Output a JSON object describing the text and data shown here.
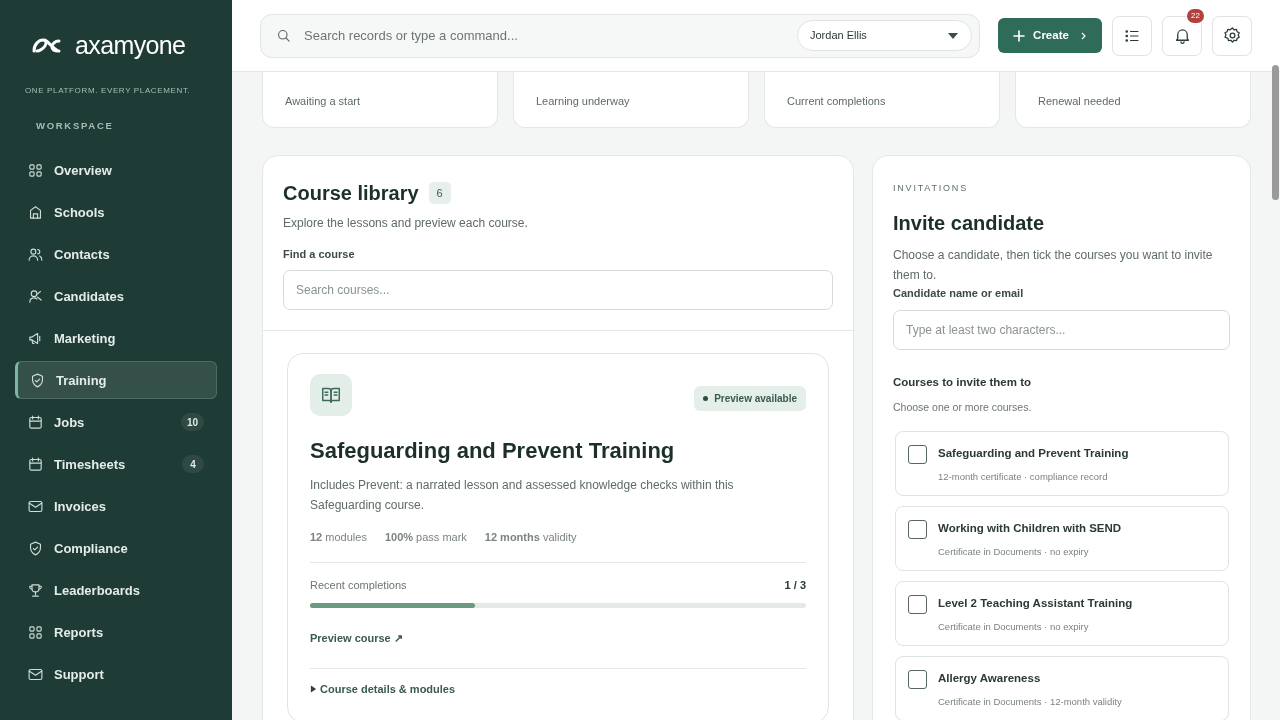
{
  "brand": {
    "name": "axamyone",
    "tagline": "ONE PLATFORM. EVERY PLACEMENT."
  },
  "sidebar": {
    "section": "WORKSPACE",
    "items": [
      {
        "label": "Overview",
        "selected": false
      },
      {
        "label": "Schools",
        "selected": false
      },
      {
        "label": "Contacts",
        "selected": false
      },
      {
        "label": "Candidates",
        "selected": false
      },
      {
        "label": "Marketing",
        "selected": false
      },
      {
        "label": "Training",
        "selected": true
      },
      {
        "label": "Jobs",
        "selected": false,
        "count": "10"
      },
      {
        "label": "Timesheets",
        "selected": false,
        "count": "4"
      },
      {
        "label": "Invoices",
        "selected": false
      },
      {
        "label": "Compliance",
        "selected": false
      },
      {
        "label": "Leaderboards",
        "selected": false
      },
      {
        "label": "Reports",
        "selected": false
      },
      {
        "label": "Support",
        "selected": false
      }
    ]
  },
  "topbar": {
    "search": {
      "placeholder": "Search records or type a command..."
    },
    "user": "Jordan Ellis",
    "create": "Create",
    "notifications": "22"
  },
  "stats": [
    {
      "label": "Awaiting a start"
    },
    {
      "label": "Learning underway"
    },
    {
      "label": "Current completions"
    },
    {
      "label": "Renewal needed"
    }
  ],
  "library": {
    "title": "Course library",
    "count": "6",
    "subtitle": "Explore the lessons and preview each course.",
    "find_label": "Find a course",
    "search": {
      "placeholder": "Search courses..."
    },
    "course": {
      "badge": "Preview available",
      "title": "Safeguarding and Prevent Training",
      "description": "Includes Prevent: a narrated lesson and assessed knowledge checks within this Safeguarding course.",
      "meta": [
        "**12** modules",
        "**100%** pass mark",
        "**12 months** validity"
      ],
      "progress_label": "Recent completions",
      "progress_reading": "1 / 3",
      "level": 0.333,
      "preview_link": "Preview course ↗",
      "details": {
        "label": "Course details & modules",
        "expanded": false
      }
    }
  },
  "invite": {
    "eyebrow": "INVITATIONS",
    "title": "Invite candidate",
    "description": "Choose a candidate, then tick the courses you want to invite them to.",
    "field_label": "Candidate name or email",
    "field": {
      "placeholder": "Type at least two characters..."
    },
    "courses_label": "Courses to invite them to",
    "courses_hint": "Choose one or more courses.",
    "courses": [
      {
        "title": "Safeguarding and Prevent Training",
        "detail": "12-month certificate · compliance record",
        "checked": false
      },
      {
        "title": "Working with Children with SEND",
        "detail": "Certificate in Documents · no expiry",
        "checked": false
      },
      {
        "title": "Level 2 Teaching Assistant Training",
        "detail": "Certificate in Documents · no expiry",
        "checked": false
      },
      {
        "title": "Allergy Awareness",
        "detail": "Certificate in Documents · 12-month validity",
        "checked": false
      }
    ]
  }
}
